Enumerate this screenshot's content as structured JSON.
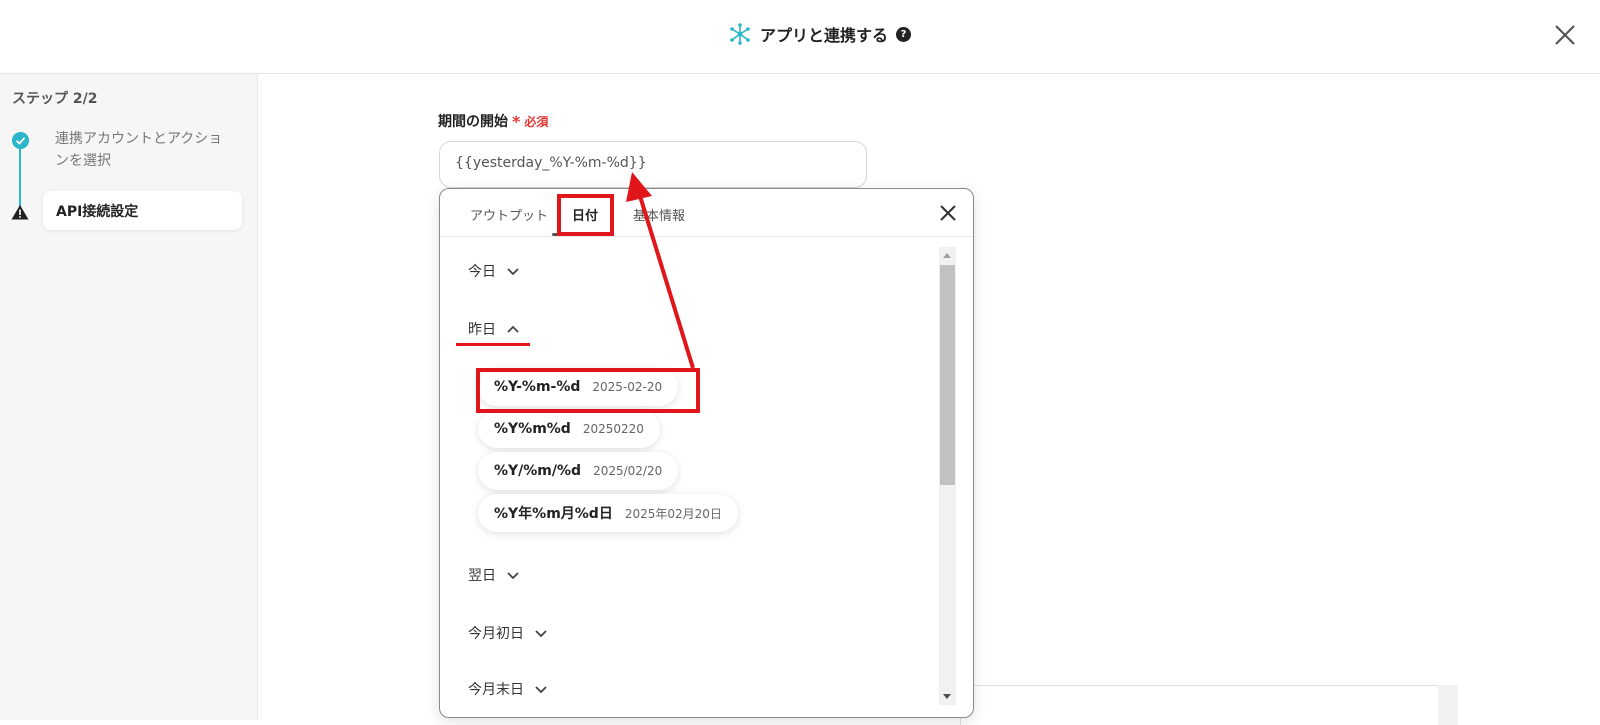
{
  "header": {
    "title": "アプリと連携する",
    "help_glyph": "?"
  },
  "sidebar": {
    "step_label": "ステップ 2/2",
    "steps": [
      {
        "label": "連携アカウントとアクションを選択",
        "status": "completed"
      },
      {
        "label": "API接続設定",
        "status": "warning"
      }
    ]
  },
  "form": {
    "field_label": "期間の開始",
    "required_mark": "*",
    "required_text": "必須",
    "field_value": "{{yesterday_%Y-%m-%d}}"
  },
  "popup": {
    "tabs": [
      {
        "label": "アウトプット",
        "active": false
      },
      {
        "label": "日付",
        "active": true
      },
      {
        "label": "基本情報",
        "active": false
      }
    ],
    "sections": [
      {
        "label": "今日",
        "expanded": false
      },
      {
        "label": "昨日",
        "expanded": true
      },
      {
        "label": "翌日",
        "expanded": false
      },
      {
        "label": "今月初日",
        "expanded": false
      },
      {
        "label": "今月末日",
        "expanded": false
      }
    ],
    "yesterday_options": [
      {
        "format": "%Y-%m-%d",
        "value": "2025-02-20"
      },
      {
        "format": "%Y%m%d",
        "value": "20250220"
      },
      {
        "format": "%Y/%m/%d",
        "value": "2025/02/20"
      },
      {
        "format": "%Y年%m月%d日",
        "value": "2025年02月20日"
      }
    ]
  },
  "colors": {
    "accent": "#2bb7c9",
    "annotation": "#e0161b",
    "required": "#e53935"
  }
}
